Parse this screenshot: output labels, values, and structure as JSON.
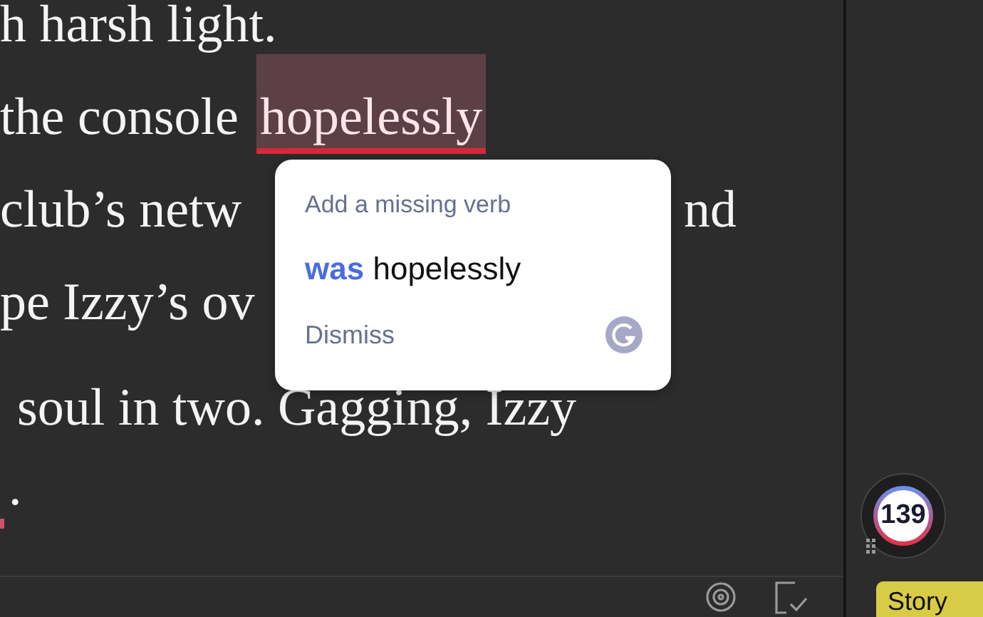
{
  "editor": {
    "lines": [
      {
        "segments": [
          {
            "text": "h harsh light.",
            "flagged": false
          }
        ]
      },
      {
        "segments": [
          {
            "text": "the console",
            "flagged": false
          },
          {
            "text": "hopelessly",
            "flagged": true
          }
        ]
      },
      {
        "segments": [
          {
            "text": "club’s netw",
            "flagged": false
          },
          {
            "text": "nd",
            "flagged": false
          }
        ]
      },
      {
        "segments": [
          {
            "text": "pe Izzy’s ov",
            "flagged": false
          }
        ]
      },
      {
        "segments": [
          {
            "text": "soul in two. Gagging, Izzy",
            "flagged": false
          }
        ]
      },
      {
        "segments": [
          {
            "text": ".",
            "flagged": false
          }
        ],
        "error_mark": true
      }
    ]
  },
  "suggestion": {
    "title": "Add a missing verb",
    "insert": "was",
    "word": "hopelessly",
    "dismiss": "Dismiss"
  },
  "score": {
    "value": "139"
  },
  "sidebar": {
    "button": "Story"
  }
}
